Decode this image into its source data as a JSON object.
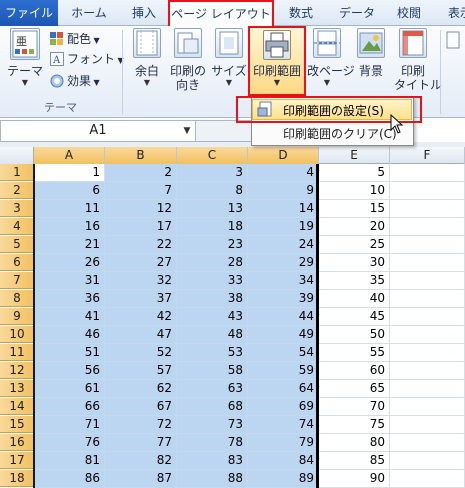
{
  "tabs": {
    "file": "ファイル",
    "home": "ホーム",
    "insert": "挿入",
    "page_layout": "ページ レイアウト",
    "formulas": "数式",
    "data": "データ",
    "review": "校閲",
    "view": "表示"
  },
  "ribbon": {
    "theme": "テーマ",
    "colors": "配色",
    "fonts": "フォント",
    "effects": "効果",
    "group_label": "テーマ",
    "margins": "余白",
    "orientation_1": "印刷の",
    "orientation_2": "向き",
    "size": "サイズ",
    "print_area": "印刷範囲",
    "breaks": "改ページ",
    "background": "背景",
    "print_titles_1": "印刷",
    "print_titles_2": "タイトル"
  },
  "dropdown": {
    "set_print_area": "印刷範囲の設定(S)",
    "clear_print_area": "印刷範囲のクリア(C)"
  },
  "formula_bar": {
    "name_box": "A1"
  },
  "sheet": {
    "columns": [
      "A",
      "B",
      "C",
      "D",
      "E",
      "F"
    ],
    "rows": [
      {
        "n": "1",
        "v": [
          "1",
          "2",
          "3",
          "4",
          "5"
        ]
      },
      {
        "n": "2",
        "v": [
          "6",
          "7",
          "8",
          "9",
          "10"
        ]
      },
      {
        "n": "3",
        "v": [
          "11",
          "12",
          "13",
          "14",
          "15"
        ]
      },
      {
        "n": "4",
        "v": [
          "16",
          "17",
          "18",
          "19",
          "20"
        ]
      },
      {
        "n": "5",
        "v": [
          "21",
          "22",
          "23",
          "24",
          "25"
        ]
      },
      {
        "n": "6",
        "v": [
          "26",
          "27",
          "28",
          "29",
          "30"
        ]
      },
      {
        "n": "7",
        "v": [
          "31",
          "32",
          "33",
          "34",
          "35"
        ]
      },
      {
        "n": "8",
        "v": [
          "36",
          "37",
          "38",
          "39",
          "40"
        ]
      },
      {
        "n": "9",
        "v": [
          "41",
          "42",
          "43",
          "44",
          "45"
        ]
      },
      {
        "n": "10",
        "v": [
          "46",
          "47",
          "48",
          "49",
          "50"
        ]
      },
      {
        "n": "11",
        "v": [
          "51",
          "52",
          "53",
          "54",
          "55"
        ]
      },
      {
        "n": "12",
        "v": [
          "56",
          "57",
          "58",
          "59",
          "60"
        ]
      },
      {
        "n": "13",
        "v": [
          "61",
          "62",
          "63",
          "64",
          "65"
        ]
      },
      {
        "n": "14",
        "v": [
          "66",
          "67",
          "68",
          "69",
          "70"
        ]
      },
      {
        "n": "15",
        "v": [
          "71",
          "72",
          "73",
          "74",
          "75"
        ]
      },
      {
        "n": "16",
        "v": [
          "76",
          "77",
          "78",
          "79",
          "80"
        ]
      },
      {
        "n": "17",
        "v": [
          "81",
          "82",
          "83",
          "84",
          "85"
        ]
      },
      {
        "n": "18",
        "v": [
          "86",
          "87",
          "88",
          "89",
          "90"
        ]
      }
    ]
  },
  "colors": {
    "highlight_frame": "#e8121b",
    "selection_fill": "#bcd6f1",
    "header_selected": "#f1c15f",
    "file_tab": "#1d56b3"
  }
}
